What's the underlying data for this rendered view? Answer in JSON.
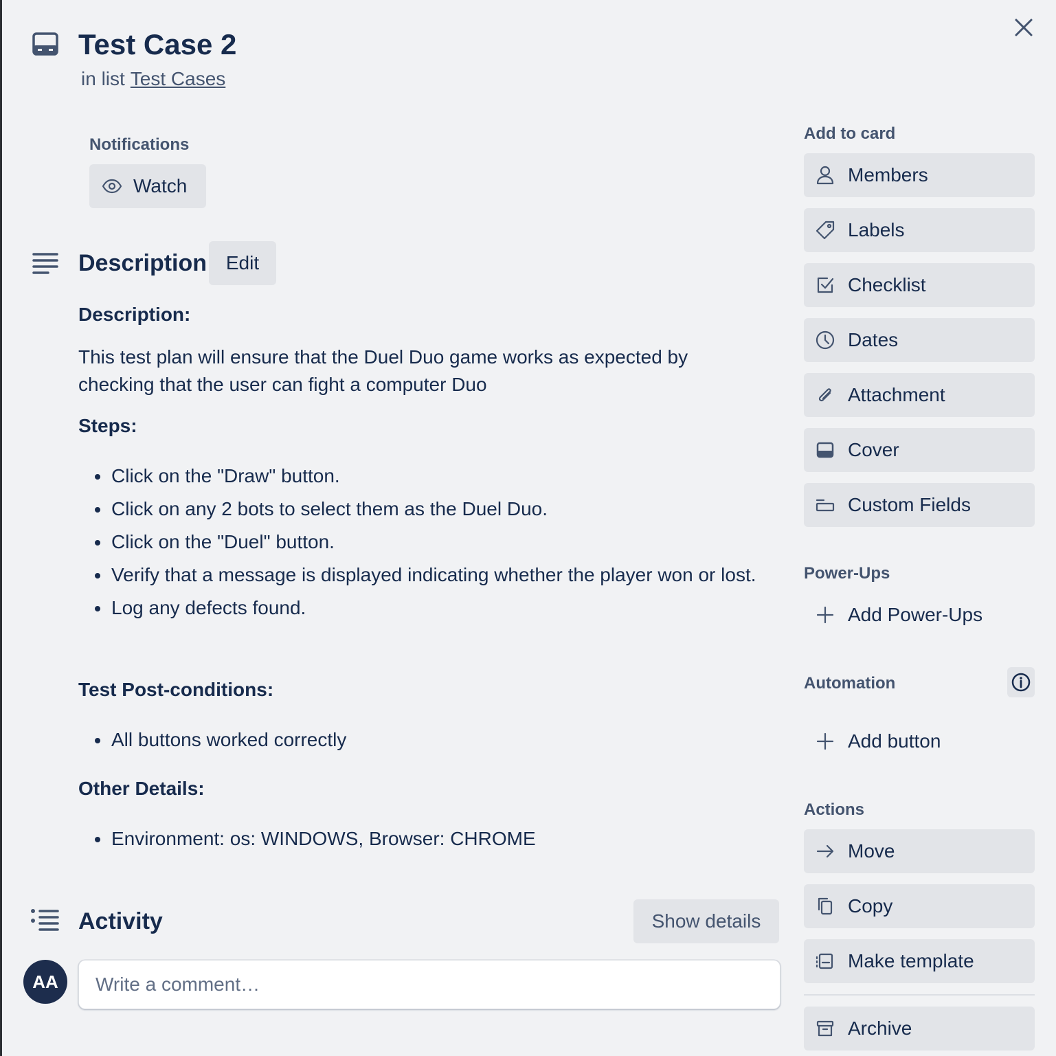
{
  "card": {
    "title": "Test Case 2",
    "list_prefix": "in list",
    "list_name": "Test Cases"
  },
  "notifications": {
    "label": "Notifications",
    "watch_label": "Watch"
  },
  "description": {
    "heading": "Description",
    "edit_label": "Edit",
    "sub_description": "Description:",
    "paragraph": "This test plan will ensure that the Duel Duo game works as expected by checking that the user can fight a computer Duo",
    "steps_heading": "Steps:",
    "steps": [
      "Click on the \"Draw\" button.",
      "Click on any 2 bots to select them as the Duel Duo.",
      "Click on the \"Duel\" button.",
      "Verify that a message is displayed indicating whether the player won or lost.",
      "Log any defects found."
    ],
    "post_heading": "Test Post-conditions:",
    "post_conditions": [
      "All buttons worked correctly"
    ],
    "other_heading": "Other Details:",
    "other_details": [
      "Environment: os: WINDOWS, Browser: CHROME"
    ]
  },
  "activity": {
    "heading": "Activity",
    "show_details_label": "Show details",
    "avatar_initials": "AA",
    "comment_placeholder": "Write a comment…"
  },
  "sidebar": {
    "add_to_card_label": "Add to card",
    "add_to_card": [
      {
        "label": "Members",
        "icon": "person-icon"
      },
      {
        "label": "Labels",
        "icon": "tag-icon"
      },
      {
        "label": "Checklist",
        "icon": "checklist-icon"
      },
      {
        "label": "Dates",
        "icon": "clock-icon"
      },
      {
        "label": "Attachment",
        "icon": "paperclip-icon"
      },
      {
        "label": "Cover",
        "icon": "cover-icon"
      },
      {
        "label": "Custom Fields",
        "icon": "custom-fields-icon"
      }
    ],
    "powerups_label": "Power-Ups",
    "add_powerups_label": "Add Power-Ups",
    "automation_label": "Automation",
    "add_button_label": "Add button",
    "actions_label": "Actions",
    "actions": [
      {
        "label": "Move",
        "icon": "arrow-right-icon"
      },
      {
        "label": "Copy",
        "icon": "copy-icon"
      },
      {
        "label": "Make template",
        "icon": "template-icon"
      },
      {
        "label": "Archive",
        "icon": "archive-icon"
      }
    ]
  },
  "colors": {
    "background": "#f1f2f4",
    "button_bg": "#e2e4e8",
    "text_primary": "#172b4d",
    "text_subtle": "#44546f",
    "avatar_bg": "#1d2d4d"
  }
}
